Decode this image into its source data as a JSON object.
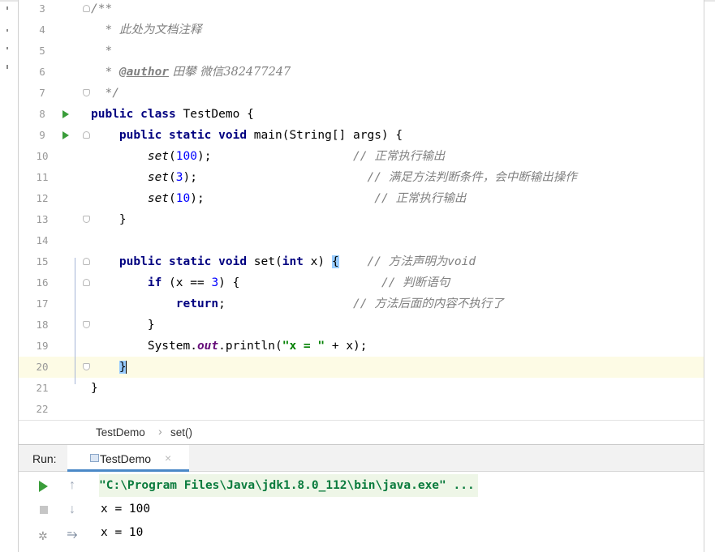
{
  "editor": {
    "lines": [
      {
        "n": "3",
        "gutter": "fold-start",
        "current": false,
        "tokens": [
          {
            "t": "/**",
            "c": "cm"
          }
        ]
      },
      {
        "n": "4",
        "gutter": "",
        "current": false,
        "tokens": [
          {
            "t": "  * ",
            "c": "cm"
          },
          {
            "t": "此处为文档注释",
            "c": "cmcn"
          }
        ]
      },
      {
        "n": "5",
        "gutter": "",
        "current": false,
        "tokens": [
          {
            "t": "  *",
            "c": "cm"
          }
        ]
      },
      {
        "n": "6",
        "gutter": "",
        "current": false,
        "tokens": [
          {
            "t": "  * ",
            "c": "cm"
          },
          {
            "t": "@author",
            "c": "tag"
          },
          {
            "t": " 田攀 微信382477247",
            "c": "cmcn"
          }
        ]
      },
      {
        "n": "7",
        "gutter": "fold-end",
        "current": false,
        "tokens": [
          {
            "t": "  */",
            "c": "cm"
          }
        ]
      },
      {
        "n": "8",
        "gutter": "run",
        "current": false,
        "tokens": [
          {
            "t": "public class ",
            "c": "kw"
          },
          {
            "t": "TestDemo {",
            "c": ""
          }
        ]
      },
      {
        "n": "9",
        "gutter": "run-fold",
        "current": false,
        "tokens": [
          {
            "t": "    public static void ",
            "c": "kw"
          },
          {
            "t": "main(String[] args) {",
            "c": ""
          }
        ]
      },
      {
        "n": "10",
        "gutter": "",
        "current": false,
        "tokens": [
          {
            "t": "        ",
            "c": ""
          },
          {
            "t": "set",
            "c": "mcall"
          },
          {
            "t": "(",
            "c": ""
          },
          {
            "t": "100",
            "c": "num"
          },
          {
            "t": ");                    ",
            "c": ""
          },
          {
            "t": "// ",
            "c": "cm"
          },
          {
            "t": "正常执行输出",
            "c": "cmcn"
          }
        ]
      },
      {
        "n": "11",
        "gutter": "",
        "current": false,
        "tokens": [
          {
            "t": "        ",
            "c": ""
          },
          {
            "t": "set",
            "c": "mcall"
          },
          {
            "t": "(",
            "c": ""
          },
          {
            "t": "3",
            "c": "num"
          },
          {
            "t": ");                        ",
            "c": ""
          },
          {
            "t": "// ",
            "c": "cm"
          },
          {
            "t": "满足方法判断条件，会中断输出操作",
            "c": "cmcn"
          }
        ]
      },
      {
        "n": "12",
        "gutter": "",
        "current": false,
        "tokens": [
          {
            "t": "        ",
            "c": ""
          },
          {
            "t": "set",
            "c": "mcall"
          },
          {
            "t": "(",
            "c": ""
          },
          {
            "t": "10",
            "c": "num"
          },
          {
            "t": ");                        ",
            "c": ""
          },
          {
            "t": "// ",
            "c": "cm"
          },
          {
            "t": "正常执行输出",
            "c": "cmcn"
          }
        ]
      },
      {
        "n": "13",
        "gutter": "fold-end",
        "current": false,
        "tokens": [
          {
            "t": "    }",
            "c": ""
          }
        ]
      },
      {
        "n": "14",
        "gutter": "",
        "current": false,
        "tokens": []
      },
      {
        "n": "15",
        "gutter": "fold-start",
        "current": false,
        "tokens": [
          {
            "t": "    public static void ",
            "c": "kw"
          },
          {
            "t": "set(",
            "c": ""
          },
          {
            "t": "int ",
            "c": "kw"
          },
          {
            "t": "x) ",
            "c": ""
          },
          {
            "t": "{",
            "c": "brace-hl"
          },
          {
            "t": "    ",
            "c": ""
          },
          {
            "t": "// ",
            "c": "cm"
          },
          {
            "t": "方法声明为",
            "c": "cmcn"
          },
          {
            "t": "void",
            "c": "cm"
          }
        ]
      },
      {
        "n": "16",
        "gutter": "fold-start",
        "current": false,
        "tokens": [
          {
            "t": "        ",
            "c": ""
          },
          {
            "t": "if ",
            "c": "kw"
          },
          {
            "t": "(x == ",
            "c": ""
          },
          {
            "t": "3",
            "c": "num"
          },
          {
            "t": ") {                    ",
            "c": ""
          },
          {
            "t": "// ",
            "c": "cm"
          },
          {
            "t": "判断语句",
            "c": "cmcn"
          }
        ]
      },
      {
        "n": "17",
        "gutter": "",
        "current": false,
        "tokens": [
          {
            "t": "            ",
            "c": ""
          },
          {
            "t": "return",
            "c": "kw"
          },
          {
            "t": ";                  ",
            "c": ""
          },
          {
            "t": "// ",
            "c": "cm"
          },
          {
            "t": "方法后面的内容不执行了",
            "c": "cmcn"
          }
        ]
      },
      {
        "n": "18",
        "gutter": "fold-end",
        "current": false,
        "tokens": [
          {
            "t": "        }",
            "c": ""
          }
        ]
      },
      {
        "n": "19",
        "gutter": "",
        "current": false,
        "tokens": [
          {
            "t": "        System.",
            "c": ""
          },
          {
            "t": "out",
            "c": "field"
          },
          {
            "t": ".println(",
            "c": ""
          },
          {
            "t": "\"x = \"",
            "c": "str"
          },
          {
            "t": " + x);",
            "c": ""
          }
        ]
      },
      {
        "n": "20",
        "gutter": "fold-end",
        "current": true,
        "tokens": [
          {
            "t": "    ",
            "c": ""
          },
          {
            "t": "}",
            "c": "brace-hl"
          },
          {
            "t": "",
            "c": "caret"
          }
        ]
      },
      {
        "n": "21",
        "gutter": "",
        "current": false,
        "tokens": [
          {
            "t": "}",
            "c": ""
          }
        ]
      },
      {
        "n": "22",
        "gutter": "",
        "current": false,
        "tokens": []
      }
    ]
  },
  "breadcrumb": {
    "class_name": "TestDemo",
    "method": "set()",
    "separator": "›"
  },
  "run_panel": {
    "label": "Run:",
    "tab_label": "TestDemo",
    "tab_close": "×",
    "tools_left": [
      {
        "icon": "play-icon"
      },
      {
        "icon": "stop-icon"
      },
      {
        "icon": "debug-icon"
      }
    ],
    "tools_right": [
      {
        "icon": "arrow-up-icon",
        "glyph": "↑"
      },
      {
        "icon": "arrow-down-icon",
        "glyph": "↓"
      },
      {
        "icon": "soft-wrap-icon",
        "glyph": "⥱"
      }
    ],
    "output": [
      "\"C:\\Program Files\\Java\\jdk1.8.0_112\\bin\\java.exe\" ...",
      "x = 100",
      "x = 10"
    ]
  },
  "colors": {
    "keyword": "#000080",
    "number": "#0000ff",
    "string": "#008000",
    "comment": "#808080",
    "current_line": "#fdfbe5",
    "brace_highlight": "#99ccff",
    "run_green": "#3a9d3a",
    "tab_underline": "#4a88c7"
  }
}
